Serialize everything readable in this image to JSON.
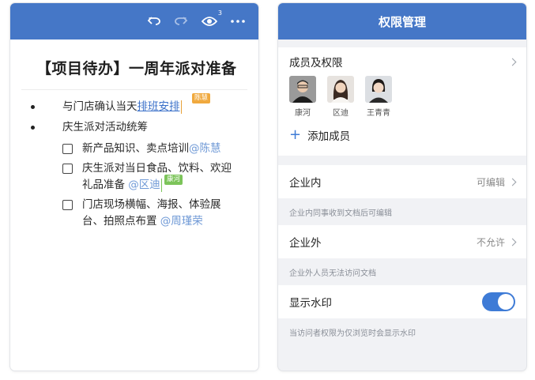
{
  "left": {
    "toolbar": {
      "undo_icon": "undo-icon",
      "redo_icon": "redo-icon",
      "viewers_count": "3",
      "eye_icon": "eye-icon",
      "more_icon": "more-icon"
    },
    "doc_title": "【项目待办】一周年派对准备",
    "bullets": [
      {
        "text_before": "与门店确认当天",
        "link": "排班安排",
        "collab_tag": "陈慧"
      },
      {
        "text_before": "庆生派对活动统筹"
      }
    ],
    "tasks": [
      {
        "line1": "新产品知识、卖点培训",
        "mention": "@陈慧"
      },
      {
        "line1": "庆生派对当日食品、饮料、欢迎",
        "line2": "礼品准备 ",
        "mention": "@区迪",
        "collab_tag": "康河"
      },
      {
        "line1": "门店现场横幅、海报、体验展",
        "line2": "台、拍照点布置 ",
        "mention": "@周瑾荣"
      }
    ]
  },
  "right": {
    "title": "权限管理",
    "members_label": "成员及权限",
    "members": [
      {
        "name": "康河"
      },
      {
        "name": "区迪"
      },
      {
        "name": "王青青"
      }
    ],
    "add_member": "添加成员",
    "internal": {
      "label": "企业内",
      "value": "可编辑",
      "hint": "企业内同事收到文档后可编辑"
    },
    "external": {
      "label": "企业外",
      "value": "不允许",
      "hint": "企业外人员无法访问文档"
    },
    "watermark": {
      "label": "显示水印",
      "enabled": true,
      "hint": "当访问者权限为仅浏览时会显示水印"
    }
  },
  "colors": {
    "header_blue": "#4577c7",
    "link_blue": "#3a70c9",
    "toggle_blue": "#3e7bd6",
    "tag_orange": "#f0a93e",
    "tag_green": "#7cc45a"
  }
}
